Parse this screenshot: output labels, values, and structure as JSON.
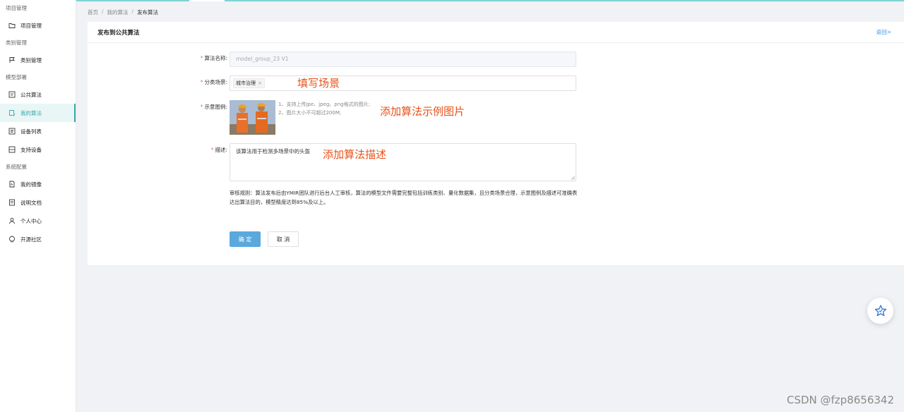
{
  "sidebar": {
    "groups": [
      {
        "label": "项目管理",
        "items": [
          {
            "label": "项目管理",
            "icon": "folder-icon"
          }
        ]
      },
      {
        "label": "类别管理",
        "items": [
          {
            "label": "类别管理",
            "icon": "flag-icon"
          }
        ]
      },
      {
        "label": "模型部署",
        "items": [
          {
            "label": "公共算法",
            "icon": "algorithm-icon"
          },
          {
            "label": "我的算法",
            "icon": "my-algorithm-icon",
            "active": true
          },
          {
            "label": "设备列表",
            "icon": "device-list-icon"
          },
          {
            "label": "支持设备",
            "icon": "supported-device-icon"
          }
        ]
      },
      {
        "label": "系统配置",
        "items": [
          {
            "label": "我的镜像",
            "icon": "image-file-icon"
          },
          {
            "label": "说明文档",
            "icon": "document-icon"
          },
          {
            "label": "个人中心",
            "icon": "user-icon"
          },
          {
            "label": "开源社区",
            "icon": "github-icon"
          }
        ]
      }
    ]
  },
  "breadcrumb": [
    "首页",
    "我的算法",
    "发布算法"
  ],
  "card": {
    "title": "发布到公共算法",
    "back": "返回>"
  },
  "form": {
    "name_label": "算法名称:",
    "name_value": "model_group_23 V1",
    "scene_label": "分类场景:",
    "scene_tag": "城市治理",
    "image_label": "示意图例:",
    "image_tips": [
      "1、支持上传jpe、jpeg、png格式的图片;",
      "2、图片大小不可超过200M;"
    ],
    "desc_label": "描述:",
    "desc_value": "该算法用于检测多场景中的头盔",
    "rules": "审核规则：算法发布后由YMIR团队进行后台人工审核，算法的模型文件需要完整包括训练类别、量化数据集，且分类场景合理，示意图例及描述可准确表达出算法目的，模型精度达到85%及以上。",
    "ok": "确 定",
    "cancel": "取 消"
  },
  "annotations": {
    "scene": "填写场景",
    "image": "添加算法示例图片",
    "desc": "添加算法描述"
  },
  "watermark": "CSDN @fzp8656342",
  "colors": {
    "accent": "#3aa7a7",
    "primary_button": "#5aa9dd",
    "annotation": "#e8521a",
    "link": "#3a8ee6"
  }
}
